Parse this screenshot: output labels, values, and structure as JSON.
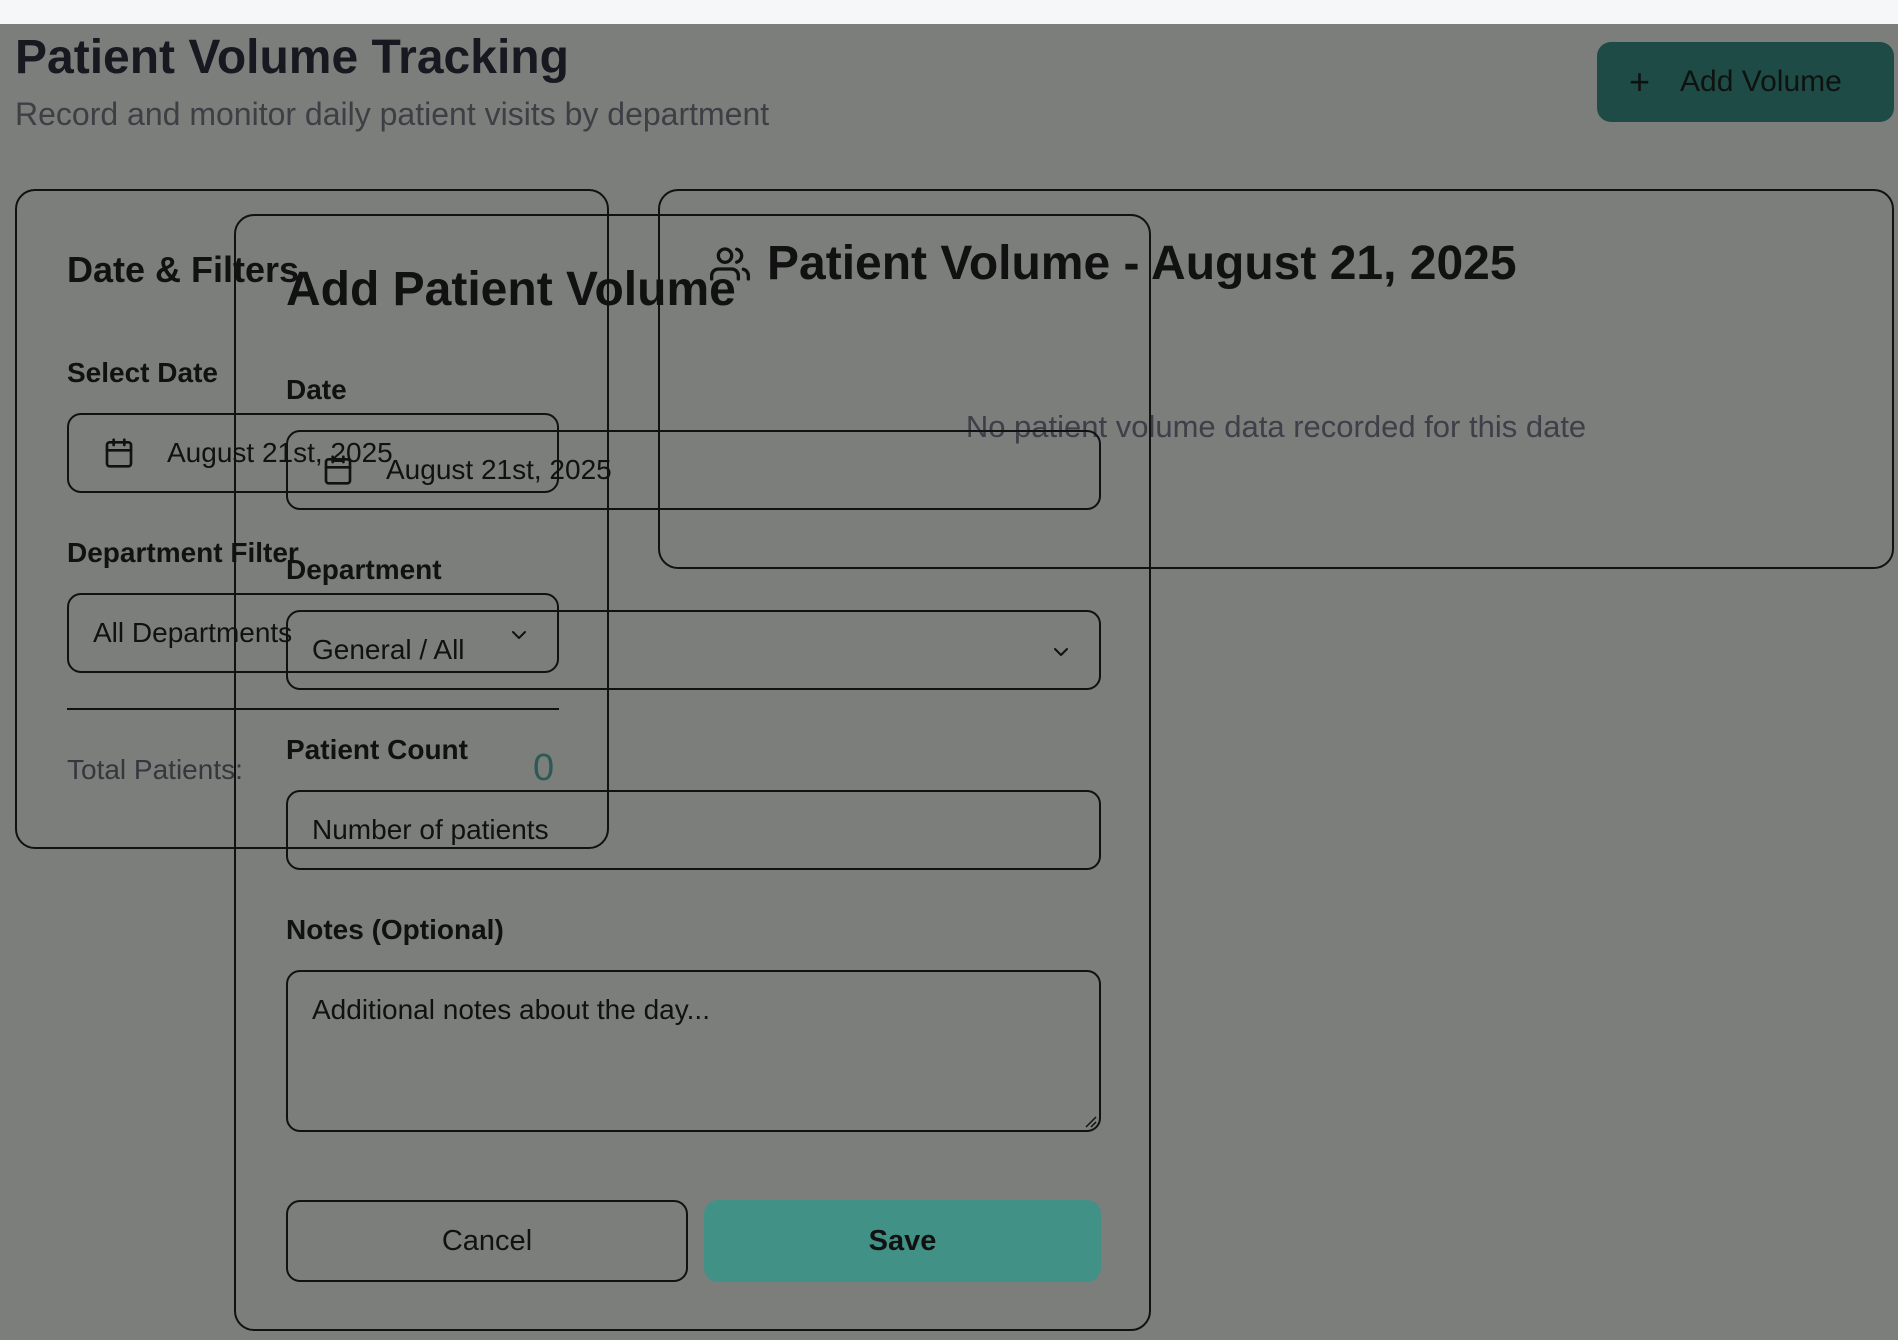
{
  "header": {
    "title": "Patient Volume Tracking",
    "subtitle": "Record and monitor daily patient visits by department",
    "add_button_label": "Add Volume"
  },
  "filters": {
    "title": "Date & Filters",
    "date_label": "Select Date",
    "date_value": "August 21st, 2025",
    "department_label": "Department Filter",
    "department_value": "All Departments",
    "total_label": "Total Patients:",
    "total_value": "0"
  },
  "volume_panel": {
    "title": "Patient Volume - August 21, 2025",
    "empty_message": "No patient volume data recorded for this date"
  },
  "modal": {
    "title": "Add Patient Volume",
    "date_label": "Date",
    "date_value": "August 21st, 2025",
    "department_label": "Department",
    "department_value": "General / All",
    "count_label": "Patient Count",
    "count_placeholder": "Number of patients",
    "notes_label": "Notes (Optional)",
    "notes_placeholder": "Additional notes about the day...",
    "cancel_label": "Cancel",
    "save_label": "Save"
  },
  "colors": {
    "overlay": "#7c7e7c",
    "primary_button": "#1e4b45",
    "save_button": "#429186",
    "total_value": "#2c5a55"
  }
}
